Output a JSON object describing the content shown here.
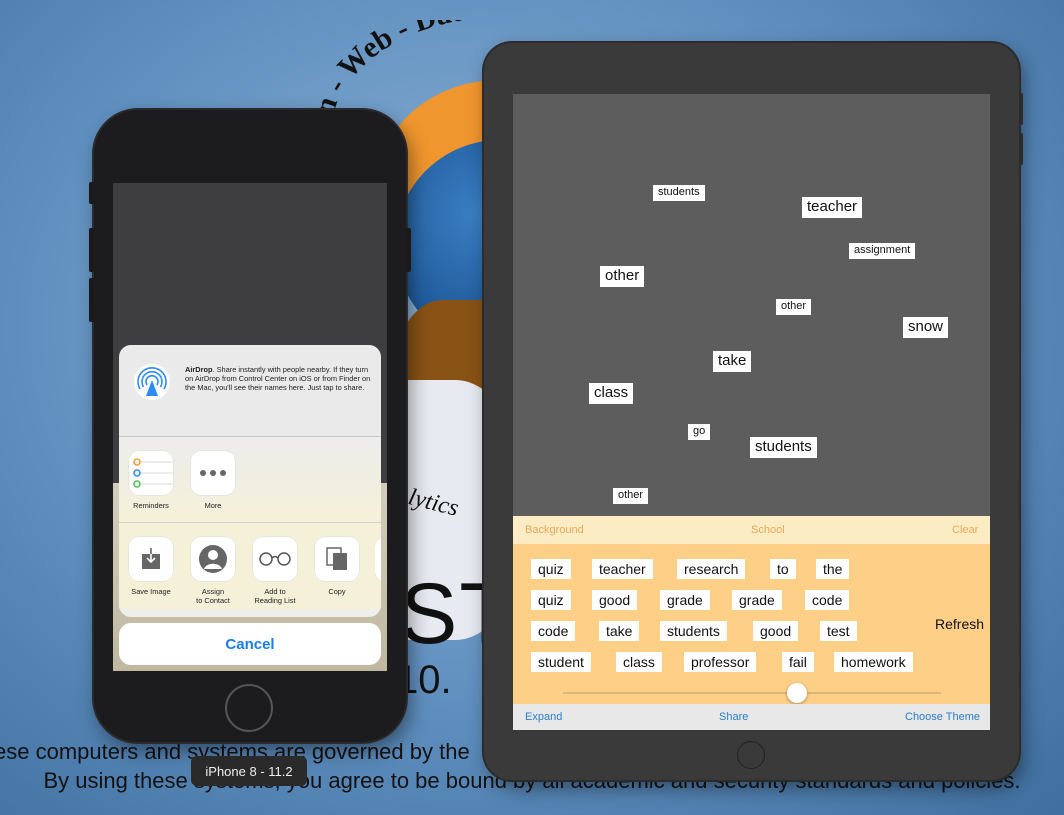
{
  "wallpaper": {
    "ring_text": "ion - Web - Database",
    "big_text": "ST",
    "version_text": "10.",
    "analytics_text": "lytics",
    "policy_line_1": "ese computers and systems are governed by the",
    "policy_line_2": "By using these systems, you agree to be bound by all academic and security standards and policies."
  },
  "simulator": {
    "device_label": "iPhone 8 - 11.2"
  },
  "iphone": {
    "airdrop": {
      "title": "AirDrop",
      "body": ". Share instantly with people nearby. If they turn on AirDrop from Control Center on iOS or from Finder on the Mac, you'll see their names here. Just tap to share."
    },
    "apps_row": [
      {
        "label": "Reminders",
        "icon": "reminders-icon"
      },
      {
        "label": "More",
        "icon": "more-icon"
      }
    ],
    "actions_row": [
      {
        "label": "Save Image",
        "icon": "save-image-icon"
      },
      {
        "label": "Assign\nto Contact",
        "icon": "contact-icon"
      },
      {
        "label": "Add to\nReading List",
        "icon": "glasses-icon"
      },
      {
        "label": "Copy",
        "icon": "copy-icon"
      }
    ],
    "cancel_label": "Cancel",
    "colors": {
      "accent": "#1a7cf2"
    }
  },
  "ipad": {
    "cloud_words": [
      {
        "text": "students",
        "size": "small"
      },
      {
        "text": "teacher",
        "size": "medium"
      },
      {
        "text": "assignment",
        "size": "small"
      },
      {
        "text": "other",
        "size": "medium"
      },
      {
        "text": "other",
        "size": "small"
      },
      {
        "text": "snow",
        "size": "medium"
      },
      {
        "text": "take",
        "size": "medium"
      },
      {
        "text": "class",
        "size": "medium"
      },
      {
        "text": "go",
        "size": "small"
      },
      {
        "text": "students",
        "size": "medium"
      },
      {
        "text": "other",
        "size": "small"
      }
    ],
    "toolbar": {
      "background": "Background",
      "theme": "School",
      "clear": "Clear"
    },
    "word_rows": [
      [
        "quiz",
        "teacher",
        "research",
        "to",
        "the"
      ],
      [
        "quiz",
        "good",
        "grade",
        "grade",
        "code"
      ],
      [
        "code",
        "take",
        "students",
        "good",
        "test"
      ],
      [
        "student",
        "class",
        "professor",
        "fail",
        "homework"
      ]
    ],
    "refresh_label": "Refresh",
    "slider_value": 0.62,
    "bottom_bar": {
      "expand": "Expand",
      "share": "Share",
      "choose_theme": "Choose Theme"
    },
    "colors": {
      "panel": "#fdcf87",
      "toolbar": "#fcecc4",
      "link": "#2b7cd3",
      "canvas": "#5d5d5d"
    }
  }
}
